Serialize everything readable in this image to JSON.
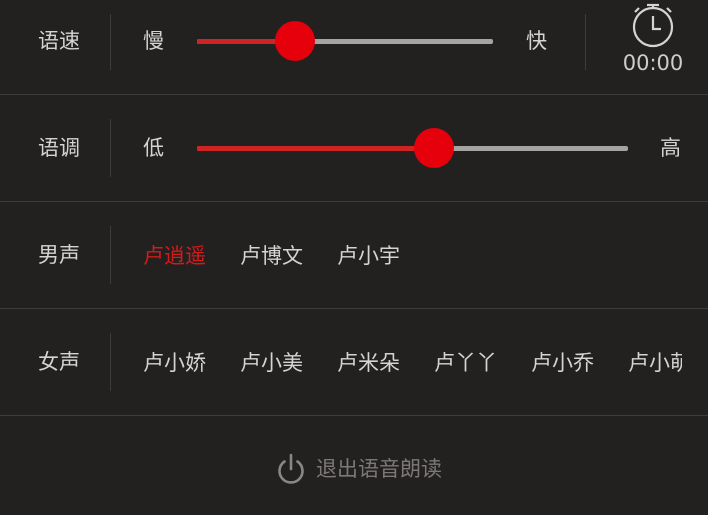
{
  "speed": {
    "label": "语速",
    "min_label": "慢",
    "max_label": "快",
    "value_percent": 33,
    "timer_text": "00:00",
    "timer_icon": "stopwatch-icon"
  },
  "pitch": {
    "label": "语调",
    "min_label": "低",
    "max_label": "高",
    "value_percent": 55
  },
  "male": {
    "label": "男声",
    "voices": [
      "卢逍遥",
      "卢博文",
      "卢小宇"
    ],
    "selected_index": 0
  },
  "female": {
    "label": "女声",
    "voices": [
      "卢小娇",
      "卢小美",
      "卢米朵",
      "卢丫丫",
      "卢小乔",
      "卢小萌"
    ]
  },
  "exit": {
    "label": "退出语音朗读",
    "icon": "power-icon"
  },
  "colors": {
    "background": "#232020",
    "accent": "#e5000c",
    "selected_text": "#d51a1a",
    "track": "#a6a3a3"
  }
}
